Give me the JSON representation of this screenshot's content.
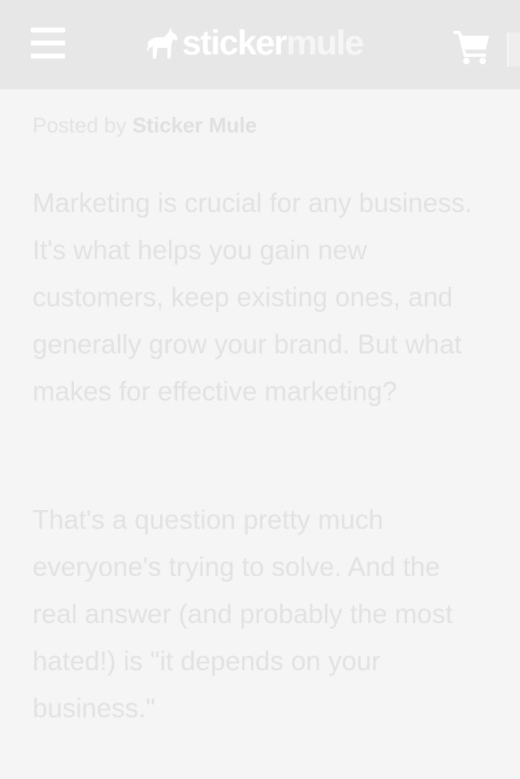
{
  "header": {
    "logo_text_primary": "sticker",
    "logo_text_secondary": "mule",
    "menu_icon": "hamburger-icon",
    "cart_icon": "cart-icon",
    "background_color": "#e7e7e7"
  },
  "post": {
    "byline_prefix": "Posted by",
    "author": "Sticker Mule",
    "paragraphs": [
      "Marketing is crucial for any business. It's what helps you gain new customers, keep existing ones, and generally grow your brand. But what makes for effective marketing?",
      "That's a question pretty much everyone's trying to solve. And the real answer (and probably the most hated!) is \"it depends on your business.\""
    ]
  }
}
